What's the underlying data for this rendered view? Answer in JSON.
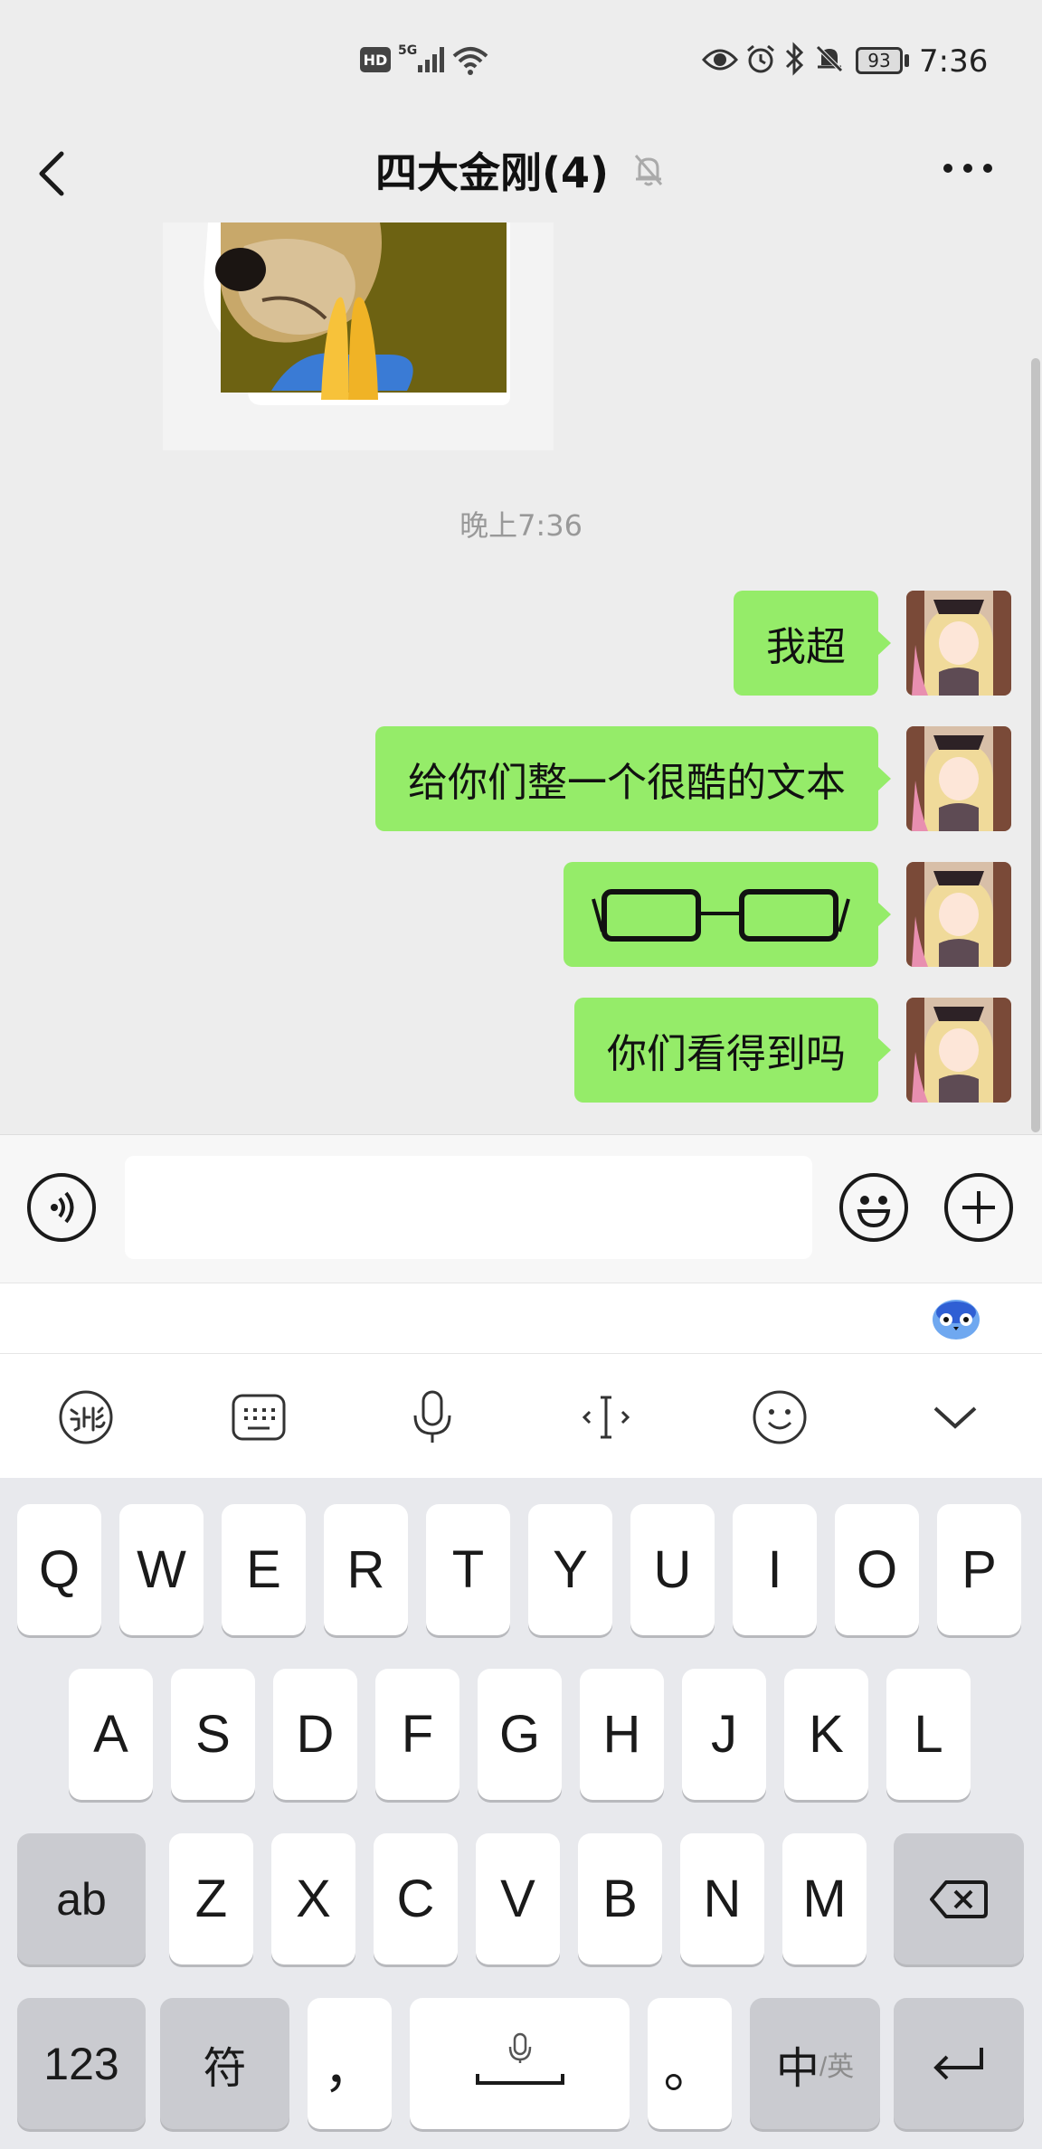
{
  "status_bar": {
    "time": "7:36",
    "battery": "93",
    "hd_label": "HD",
    "network_label": "5G"
  },
  "nav": {
    "title": "四大金刚(4)"
  },
  "chat": {
    "timestamp": "晚上7:36",
    "messages": [
      {
        "type": "text",
        "text": "我超"
      },
      {
        "type": "text",
        "text": "给你们整一个很酷的文本"
      },
      {
        "type": "glasses-sticker",
        "text": ""
      },
      {
        "type": "text",
        "text": "你们看得到吗"
      }
    ]
  },
  "input": {
    "value": "",
    "placeholder": ""
  },
  "ime_toolbar": {
    "items": [
      "ime-logo-icon",
      "keyboard-layout-icon",
      "microphone-icon",
      "cursor-move-icon",
      "emoji-icon",
      "collapse-keyboard-icon"
    ]
  },
  "keyboard": {
    "row1": [
      "Q",
      "W",
      "E",
      "R",
      "T",
      "Y",
      "U",
      "I",
      "O",
      "P"
    ],
    "row2": [
      "A",
      "S",
      "D",
      "F",
      "G",
      "H",
      "J",
      "K",
      "L"
    ],
    "row3_left": "ab",
    "row3": [
      "Z",
      "X",
      "C",
      "V",
      "B",
      "N",
      "M"
    ],
    "row4": {
      "num": "123",
      "symbol": "符",
      "comma": "，",
      "period": "。",
      "lang_main": "中",
      "lang_sub": "/英"
    }
  },
  "colors": {
    "bubble": "#95ec69",
    "chat_bg": "#ededed",
    "keyboard_bg": "#e8e9ed"
  }
}
